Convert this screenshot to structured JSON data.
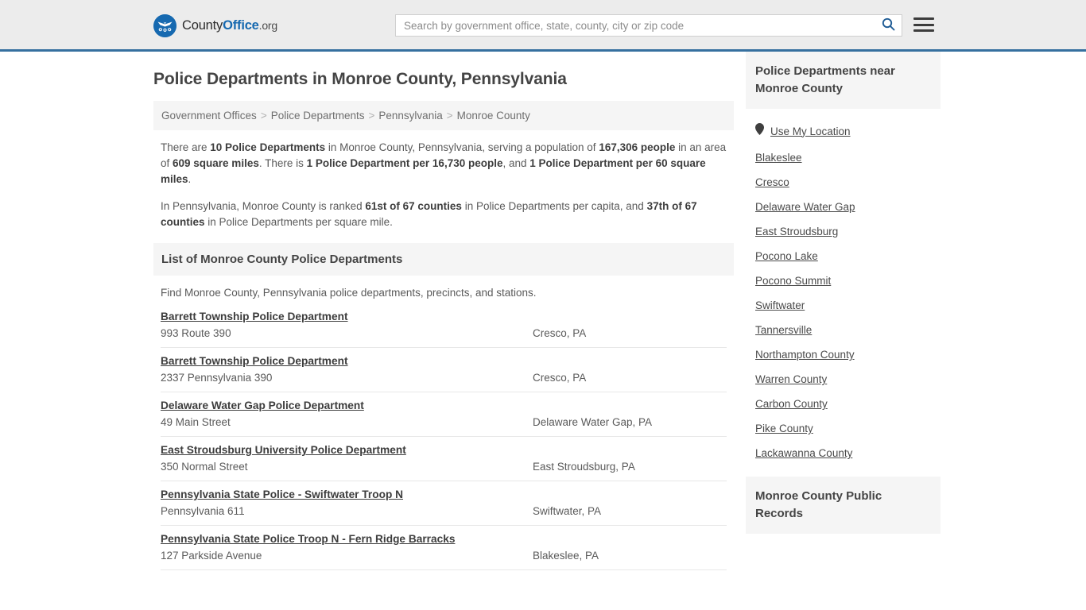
{
  "header": {
    "logo": {
      "icon": "eagle-shield-logo",
      "text_county": "County",
      "text_office": "Office",
      "text_org": ".org"
    },
    "search": {
      "placeholder": "Search by government office, state, county, city or zip code",
      "value": "",
      "search_icon": "search-icon"
    },
    "menu_icon": "hamburger-menu-icon",
    "accent_color": "#36709f",
    "background_color": "#ececec"
  },
  "main": {
    "title": "Police Departments in Monroe County, Pennsylvania",
    "breadcrumb": {
      "separator": ">",
      "items": [
        "Government Offices",
        "Police Departments",
        "Pennsylvania",
        "Monroe County"
      ]
    },
    "intro_paragraph_1": {
      "part1": "There are ",
      "b1": "10 Police Departments",
      "part2": " in Monroe County, Pennsylvania, serving a population of ",
      "b2": "167,306 people",
      "part3": " in an area of ",
      "b3": "609 square miles",
      "part4": ". There is ",
      "b4": "1 Police Department per 16,730 people",
      "part5": ", and ",
      "b5": "1 Police Department per 60 square miles",
      "part6": "."
    },
    "intro_paragraph_2": {
      "part1": "In Pennsylvania, Monroe County is ranked ",
      "b1": "61st of 67 counties",
      "part2": " in Police Departments per capita, and ",
      "b2": "37th of 67 counties",
      "part3": " in Police Departments per square mile."
    },
    "section_heading": "List of Monroe County Police Departments",
    "section_subtext": "Find Monroe County, Pennsylvania police departments, precincts, and stations.",
    "listings": [
      {
        "name": "Barrett Township Police Department",
        "address": "993 Route 390",
        "city_state": "Cresco, PA"
      },
      {
        "name": "Barrett Township Police Department",
        "address": "2337 Pennsylvania 390",
        "city_state": "Cresco, PA"
      },
      {
        "name": "Delaware Water Gap Police Department",
        "address": "49 Main Street",
        "city_state": "Delaware Water Gap, PA"
      },
      {
        "name": "East Stroudsburg University Police Department",
        "address": "350 Normal Street",
        "city_state": "East Stroudsburg, PA"
      },
      {
        "name": "Pennsylvania State Police - Swiftwater Troop N",
        "address": "Pennsylvania 611",
        "city_state": "Swiftwater, PA"
      },
      {
        "name": "Pennsylvania State Police Troop N - Fern Ridge Barracks",
        "address": "127 Parkside Avenue",
        "city_state": "Blakeslee, PA"
      }
    ]
  },
  "sidebar": {
    "nearby_heading": "Police Departments near Monroe County",
    "use_my_location": {
      "label": "Use My Location",
      "icon": "map-pin-icon"
    },
    "nearby_links": [
      "Blakeslee",
      "Cresco",
      "Delaware Water Gap",
      "East Stroudsburg",
      "Pocono Lake",
      "Pocono Summit",
      "Swiftwater",
      "Tannersville",
      "Northampton County",
      "Warren County",
      "Carbon County",
      "Pike County",
      "Lackawanna County"
    ],
    "public_records_heading": "Monroe County Public Records"
  }
}
